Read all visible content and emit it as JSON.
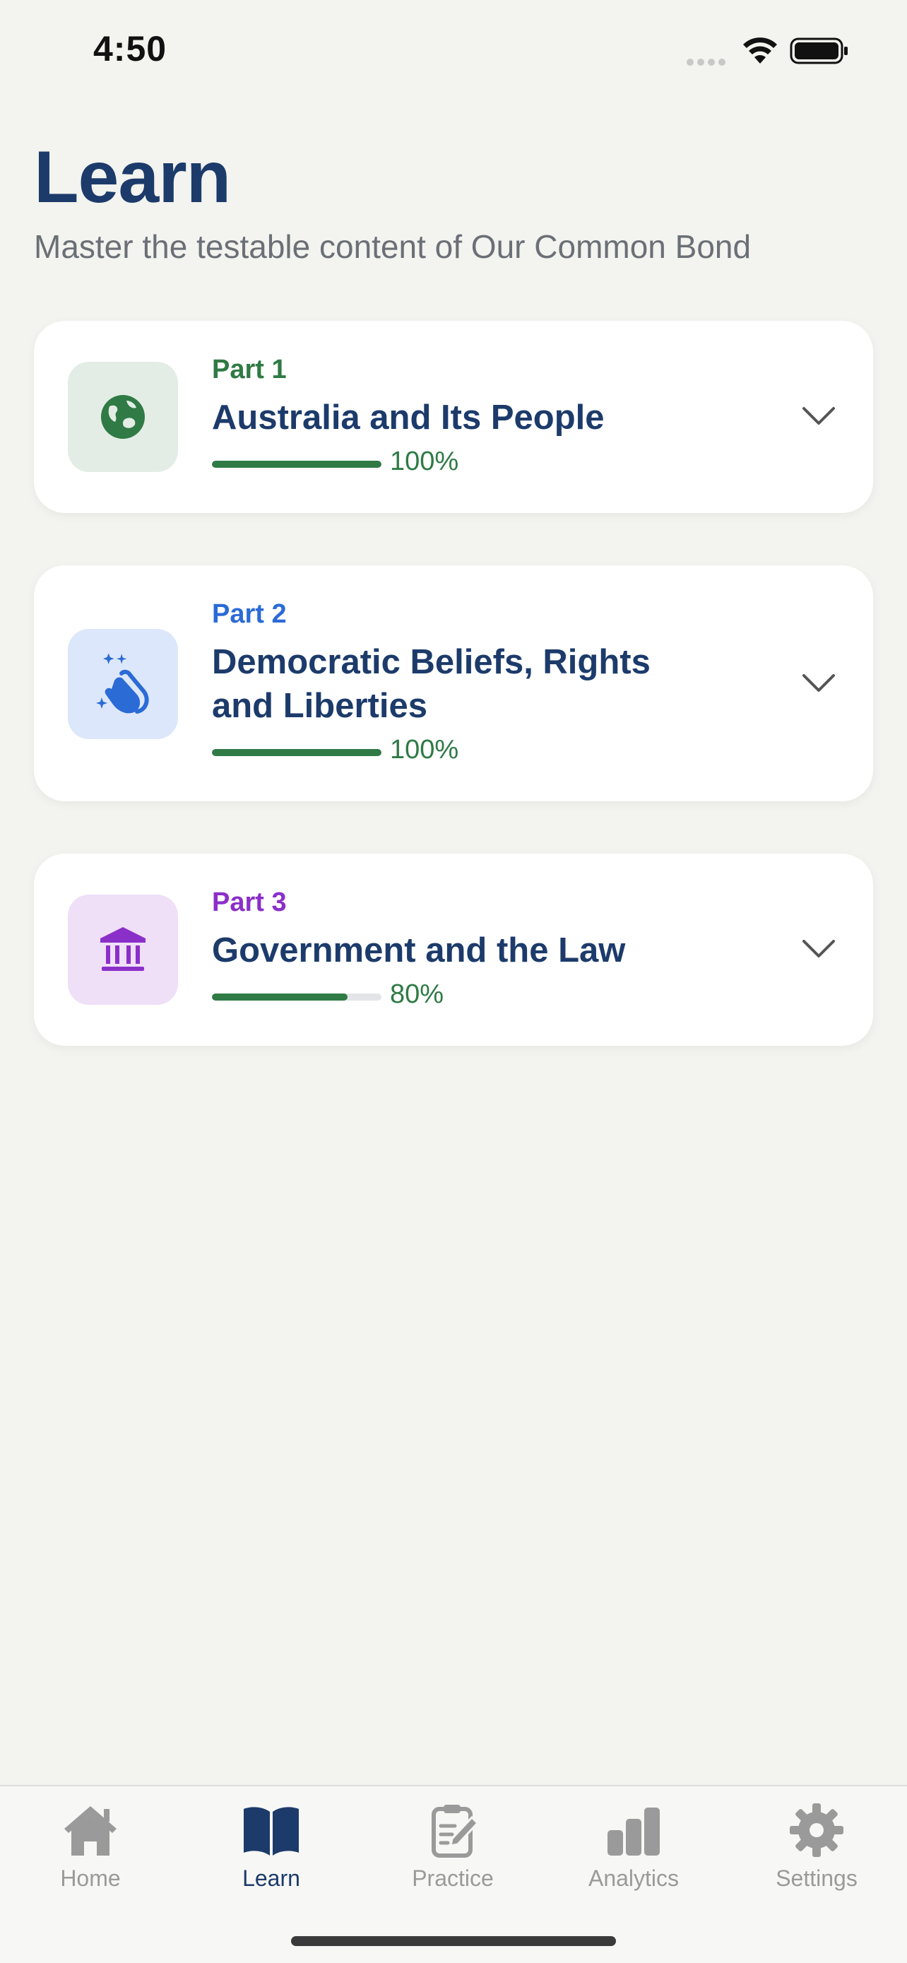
{
  "status_bar": {
    "time": "4:50"
  },
  "header": {
    "title": "Learn",
    "subtitle": "Master the testable content of Our Common Bond"
  },
  "cards": [
    {
      "part": "Part 1",
      "title": "Australia and Its People",
      "progress_percent": 100,
      "progress_label": "100%",
      "icon": "globe-icon",
      "accent_color": "#2f7a45",
      "icon_bg": "#e3ede5"
    },
    {
      "part": "Part 2",
      "title": "Democratic Beliefs, Rights and Liberties",
      "progress_percent": 100,
      "progress_label": "100%",
      "icon": "clapping-hands-icon",
      "accent_color": "#2b6bd6",
      "icon_bg": "#dde7fb"
    },
    {
      "part": "Part 3",
      "title": "Government and the Law",
      "progress_percent": 80,
      "progress_label": "80%",
      "icon": "government-building-icon",
      "accent_color": "#8b2fc9",
      "icon_bg": "#efdff7"
    }
  ],
  "tab_bar": {
    "items": [
      {
        "label": "Home",
        "icon": "house-icon",
        "active": false
      },
      {
        "label": "Learn",
        "icon": "open-book-icon",
        "active": true
      },
      {
        "label": "Practice",
        "icon": "clipboard-pencil-icon",
        "active": false
      },
      {
        "label": "Analytics",
        "icon": "bar-chart-icon",
        "active": false
      },
      {
        "label": "Settings",
        "icon": "gear-icon",
        "active": false
      }
    ]
  },
  "colors": {
    "background": "#f3f3ef",
    "title": "#1c3b6b",
    "progress": "#2f7a45",
    "tab_inactive": "#9a9a9a"
  }
}
